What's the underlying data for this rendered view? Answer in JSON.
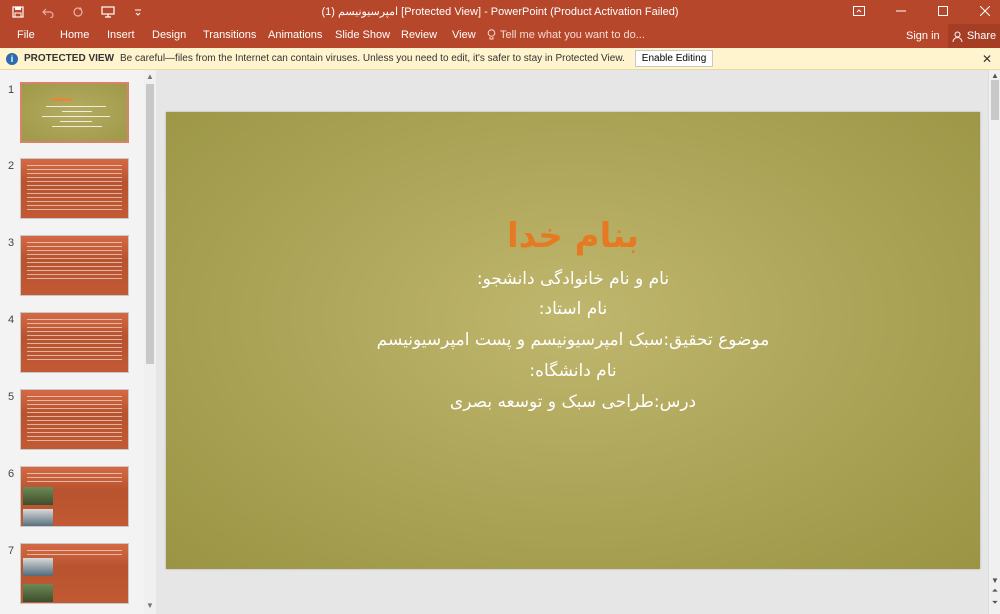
{
  "window": {
    "title": "امپرسیونیسم (1) [Protected View] - PowerPoint (Product Activation Failed)",
    "accent": "#b7472a"
  },
  "qat": {
    "icons": [
      "save-icon",
      "undo-icon",
      "redo-icon",
      "slideshow-from-start-icon",
      "customize-qat-icon"
    ]
  },
  "ribbon": {
    "tabs": [
      "File",
      "Home",
      "Insert",
      "Design",
      "Transitions",
      "Animations",
      "Slide Show",
      "Review",
      "View"
    ],
    "tell_me": "Tell me what you want to do...",
    "sign_in": "Sign in",
    "share": "Share"
  },
  "protected_view": {
    "title": "PROTECTED VIEW",
    "message": "Be careful—files from the Internet can contain viruses. Unless you need to edit, it's safer to stay in Protected View.",
    "enable_button": "Enable Editing"
  },
  "thumbnails": {
    "numbers": [
      "1",
      "2",
      "3",
      "4",
      "5",
      "6",
      "7"
    ],
    "selected": 1
  },
  "slide": {
    "title": "بنام خدا",
    "lines": [
      "نام و نام خانوادگی دانشجو:",
      "نام استاد:",
      "موضوع تحقیق:سبک امپرسیونیسم و پست امپرسیونیسم",
      "نام دانشگاه:",
      "درس:طراحی سبک و توسعه بصری"
    ],
    "title_color": "#e67a22",
    "background_color": "#b0a85c"
  }
}
